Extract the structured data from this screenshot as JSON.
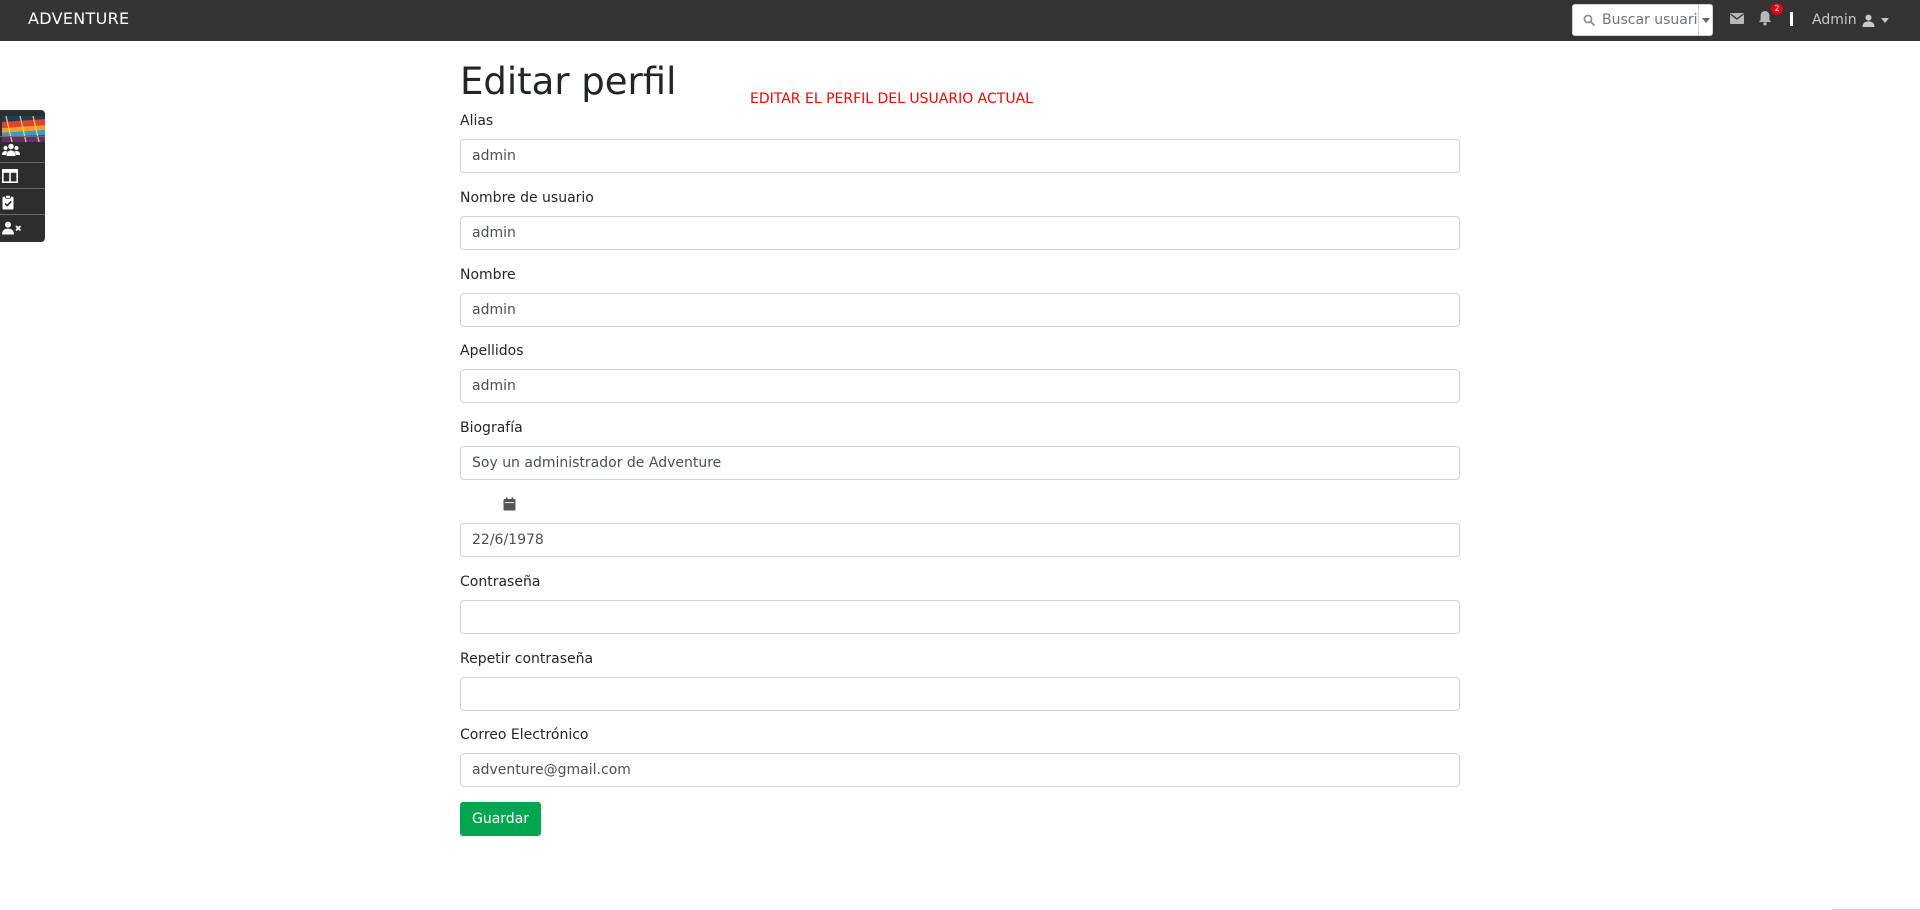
{
  "navbar": {
    "brand": "ADVENTURE",
    "search": {
      "placeholder": "Buscar usuario"
    },
    "notifications": {
      "count": "2"
    },
    "user": {
      "name": "Admin"
    }
  },
  "side_menu": {
    "items": [
      {
        "icon": "avatar-image"
      },
      {
        "icon": "users-icon"
      },
      {
        "icon": "columns-icon"
      },
      {
        "icon": "clipboard-check-icon"
      },
      {
        "icon": "user-times-icon"
      }
    ]
  },
  "page": {
    "title": "Editar perfil",
    "note": "EDITAR EL PERFIL DEL USUARIO ACTUAL",
    "note_color": "#ff0000"
  },
  "form": {
    "alias": {
      "label": "Alias",
      "value": "admin"
    },
    "username": {
      "label": "Nombre de usuario",
      "value": "admin"
    },
    "first_name": {
      "label": "Nombre",
      "value": "admin"
    },
    "last_name": {
      "label": "Apellidos",
      "value": "admin"
    },
    "bio": {
      "label": "Biografía",
      "value": "Soy un administrador de Adventure"
    },
    "birthdate": {
      "icon": "calendar-icon",
      "value": "22/6/1978"
    },
    "password": {
      "label": "Contraseña",
      "value": ""
    },
    "password_repeat": {
      "label": "Repetir contraseña",
      "value": ""
    },
    "email": {
      "label": "Correo Electrónico",
      "value": "adventure@gmail.com"
    },
    "save_label": "Guardar",
    "save_color": "#00a650"
  }
}
